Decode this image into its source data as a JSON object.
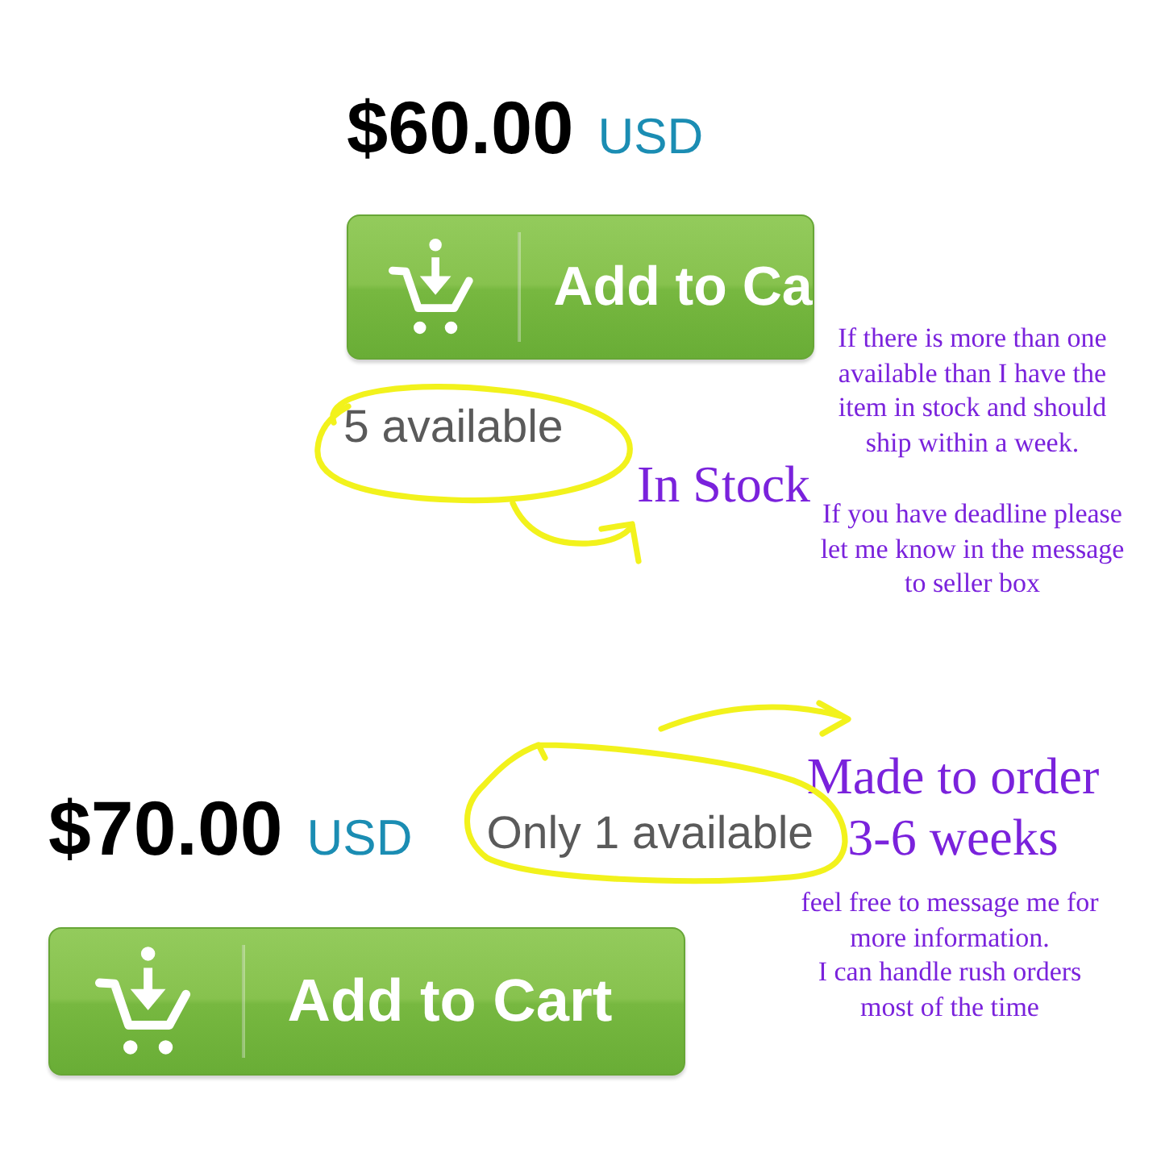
{
  "listings": [
    {
      "kind": "stacked",
      "price": "$60.00",
      "currency": "USD",
      "cart_button": "Add to Ca",
      "availability": "5 available"
    },
    {
      "kind": "inline",
      "price": "$70.00",
      "currency": "USD",
      "cart_button": "Add to Cart",
      "availability": "Only 1 available"
    }
  ],
  "annotations": [
    {
      "kind": "heading",
      "text": "In Stock"
    },
    {
      "kind": "detail",
      "text": "If there is more than one\navailable than I have the\nitem in stock and should\nship within a week."
    },
    {
      "kind": "detail",
      "text": "If you have deadline please\nlet me know in the message\nto seller box"
    },
    {
      "kind": "heading",
      "text": "Made to order\n3-6 weeks"
    },
    {
      "kind": "detail",
      "text": "feel free to message me for\nmore information.\nI can handle rush orders\nmost of the time"
    }
  ]
}
